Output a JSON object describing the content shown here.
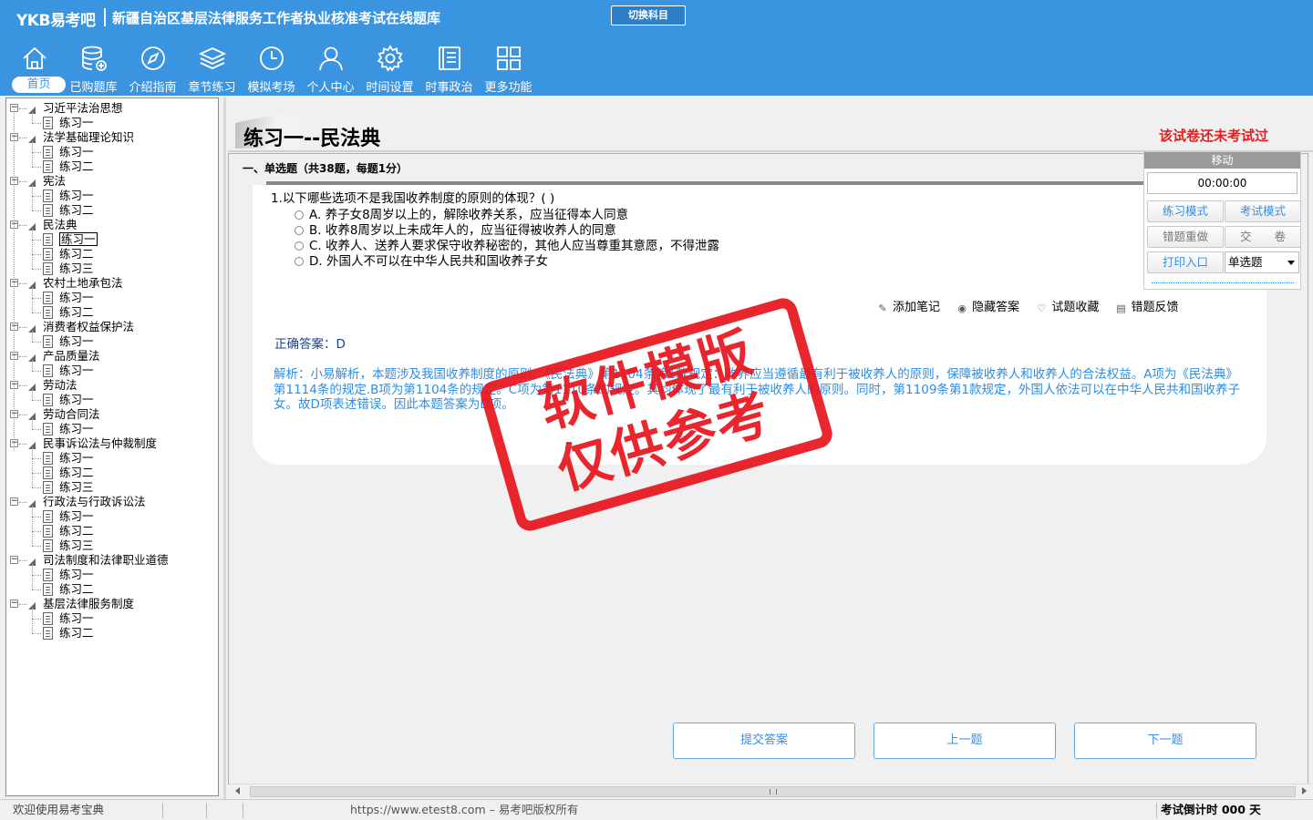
{
  "header": {
    "logo": "YKB易考吧",
    "title": "新疆自治区基层法律服务工作者执业核准考试在线题库",
    "switch_subject": "切换科目",
    "brand_color": "#3b94e0"
  },
  "nav": [
    {
      "label": "首页",
      "icon": "home-icon",
      "active": true
    },
    {
      "label": "已购题库",
      "icon": "database-icon"
    },
    {
      "label": "介绍指南",
      "icon": "compass-icon"
    },
    {
      "label": "章节练习",
      "icon": "layers-icon"
    },
    {
      "label": "模拟考场",
      "icon": "clock-icon"
    },
    {
      "label": "个人中心",
      "icon": "user-icon"
    },
    {
      "label": "时间设置",
      "icon": "gear-icon"
    },
    {
      "label": "时事政治",
      "icon": "news-icon"
    },
    {
      "label": "更多功能",
      "icon": "grid-icon"
    }
  ],
  "tree": [
    {
      "label": "习近平法治思想",
      "children": [
        "练习一"
      ]
    },
    {
      "label": "法学基础理论知识",
      "children": [
        "练习一",
        "练习二"
      ]
    },
    {
      "label": "宪法",
      "children": [
        "练习一",
        "练习二"
      ]
    },
    {
      "label": "民法典",
      "children": [
        "练习一",
        "练习二",
        "练习三"
      ],
      "selected_child": 0
    },
    {
      "label": "农村土地承包法",
      "children": [
        "练习一",
        "练习二"
      ]
    },
    {
      "label": "消费者权益保护法",
      "children": [
        "练习一"
      ]
    },
    {
      "label": "产品质量法",
      "children": [
        "练习一"
      ]
    },
    {
      "label": "劳动法",
      "children": [
        "练习一"
      ]
    },
    {
      "label": "劳动合同法",
      "children": [
        "练习一"
      ]
    },
    {
      "label": "民事诉讼法与仲裁制度",
      "children": [
        "练习一",
        "练习二",
        "练习三"
      ]
    },
    {
      "label": "行政法与行政诉讼法",
      "children": [
        "练习一",
        "练习二",
        "练习三"
      ]
    },
    {
      "label": "司法制度和法律职业道德",
      "children": [
        "练习一",
        "练习二"
      ]
    },
    {
      "label": "基层法律服务制度",
      "children": [
        "练习一",
        "练习二"
      ]
    }
  ],
  "exam": {
    "title": "练习一--民法典",
    "status": "该试卷还未考试过",
    "section_header": "一、单选题（共38题，每题1分）"
  },
  "question": {
    "text": "1.以下哪些选项不是我国收养制度的原则的体现？( )",
    "options": [
      "A. 养子女8周岁以上的，解除收养关系，应当征得本人同意",
      "B. 收养8周岁以上未成年人的，应当征得被收养人的同意",
      "C. 收养人、送养人要求保守收养秘密的，其他人应当尊重其意愿，不得泄露",
      "D. 外国人不可以在中华人民共和国收养子女"
    ],
    "tools": {
      "add_note": "添加笔记",
      "hide_answer": "隐藏答案",
      "favorite": "试题收藏",
      "feedback": "错题反馈"
    },
    "answer": "正确答案：D",
    "analysis": "解析：小易解析，本题涉及我国收养制度的原则。《民法典》第1104条第1款规定：收养应当遵循最有利于被收养人的原则，保障被收养人和收养人的合法权益。A项为《民法典》第1114条的规定.B项为第1104条的规定。C项为第1110条的规定。其均体现了最有利于被收养人的原则。同时，第1109条第1款规定，外国人依法可以在中华人民共和国收养子女。故D项表述错误。因此本题答案为D项。"
  },
  "control_panel": {
    "move": "移动",
    "timer": "00:00:00",
    "practice_mode": "练习模式",
    "exam_mode": "考试模式",
    "redo_wrong": "错题重做",
    "submit_paper": "交　　卷",
    "print": "打印入口",
    "question_type": "单选题"
  },
  "buttons": {
    "submit_answer": "提交答案",
    "prev": "上一题",
    "next": "下一题"
  },
  "status": {
    "welcome": "欢迎使用易考宝典",
    "url": "https://www.etest8.com – 易考吧版权所有",
    "countdown": "考试倒计时 000 天"
  },
  "watermark": {
    "line1": "软件模版",
    "line2": "仅供参考",
    "color": "#e8141c"
  }
}
